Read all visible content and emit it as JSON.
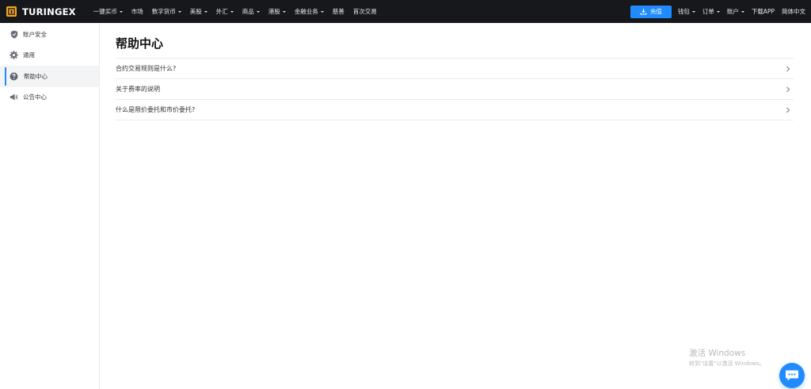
{
  "brand": {
    "name": "TURINGEX"
  },
  "nav": {
    "items": [
      {
        "label": "一键买币",
        "dropdown": true
      },
      {
        "label": "市场",
        "dropdown": false
      },
      {
        "label": "数字货币",
        "dropdown": true
      },
      {
        "label": "美股",
        "dropdown": true
      },
      {
        "label": "外汇",
        "dropdown": true
      },
      {
        "label": "商品",
        "dropdown": true
      },
      {
        "label": "港股",
        "dropdown": true
      },
      {
        "label": "金融业务",
        "dropdown": true
      },
      {
        "label": "慈善",
        "dropdown": false
      },
      {
        "label": "首次交易",
        "dropdown": false
      }
    ]
  },
  "right_nav": {
    "deposit_label": "充值",
    "wallet_label": "钱包",
    "orders_label": "订单",
    "account_label": "账户",
    "download_label": "下载APP",
    "language_label": "简体中文"
  },
  "sidebar": {
    "items": [
      {
        "label": "账户安全",
        "icon": "shield-icon",
        "active": false
      },
      {
        "label": "通用",
        "icon": "gear-icon",
        "active": false
      },
      {
        "label": "帮助中心",
        "icon": "question-icon",
        "active": true
      },
      {
        "label": "公告中心",
        "icon": "megaphone-icon",
        "active": false
      }
    ]
  },
  "main": {
    "title": "帮助中心",
    "faq": [
      {
        "label": "合约交易规则是什么?"
      },
      {
        "label": "关于费率的说明"
      },
      {
        "label": "什么是限价委托和市价委托?"
      }
    ]
  },
  "watermark": {
    "title": "激活 Windows",
    "subtitle": "转到\"设置\"以激活 Windows。"
  },
  "colors": {
    "topbar_bg": "#17181c",
    "accent": "#1f8bff",
    "logo": "#f5a623"
  }
}
